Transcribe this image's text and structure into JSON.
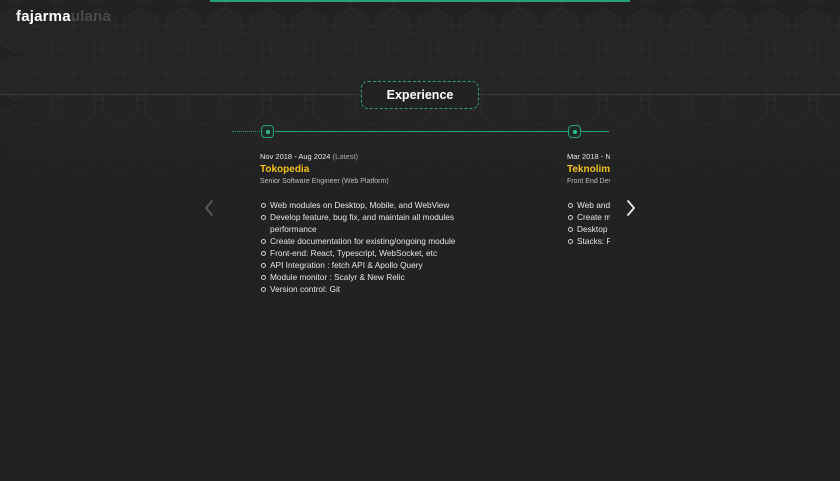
{
  "logo": {
    "part1": "fajarma",
    "part2": "ulana"
  },
  "section": {
    "title": "Experience"
  },
  "experiences": [
    {
      "date": "Nov 2018 - Aug 2024",
      "badge": "(Latest)",
      "company": "Tokopedia",
      "role": "Senior Software Engineer (Web Platform)",
      "items": [
        "Web modules on Desktop, Mobile, and WebView",
        "Develop feature, bug fix, and maintain all modules performance",
        "Create documentation for existing/ongoing module",
        "Front-end: React, Typescript, WebSocket, etc",
        "API Integration : fetch API & Apollo Query",
        "Module monitor : Scalyr & New Relic",
        "Version control: Git"
      ]
    },
    {
      "date": "Mar 2018 - N",
      "badge": "",
      "company": "Teknolim",
      "role": "Front End Dev",
      "items": [
        "Web and",
        "Create m",
        "Desktop",
        "Stacks: F"
      ]
    }
  ],
  "controls": {
    "prev_icon": "chevron-left-icon",
    "next_icon": "chevron-right-icon"
  },
  "colors": {
    "background": "#222222",
    "accent": "#2aa07a",
    "company": "#f2c21b",
    "logo_dim": "#4a4a4a"
  }
}
